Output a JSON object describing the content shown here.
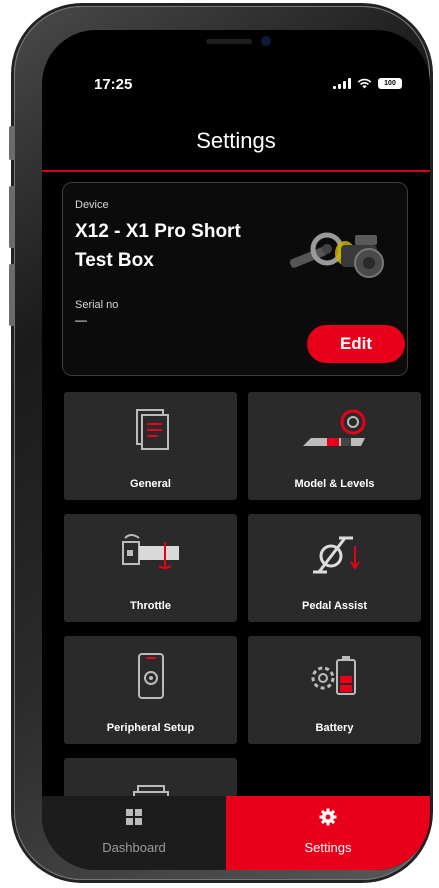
{
  "status_bar": {
    "time": "17:25",
    "battery": "100"
  },
  "header": {
    "title": "Settings"
  },
  "device_card": {
    "device_label": "Device",
    "device_name": "X12 - X1 Pro Short Test Box",
    "serial_label": "Serial no",
    "serial_value": "—",
    "edit_label": "Edit"
  },
  "tiles": [
    {
      "label": "General",
      "icon": "documents-icon"
    },
    {
      "label": "Model & Levels",
      "icon": "model-levels-icon"
    },
    {
      "label": "Throttle",
      "icon": "throttle-icon"
    },
    {
      "label": "Pedal Assist",
      "icon": "pedal-assist-icon"
    },
    {
      "label": "Peripheral Setup",
      "icon": "peripheral-setup-icon"
    },
    {
      "label": "Battery",
      "icon": "battery-settings-icon"
    }
  ],
  "tab_bar": {
    "tabs": [
      {
        "label": "Dashboard",
        "icon": "grid-icon",
        "active": false
      },
      {
        "label": "Settings",
        "icon": "gear-icon",
        "active": true
      }
    ]
  },
  "colors": {
    "accent": "#e8001b",
    "tile_bg": "#2a2a2a",
    "screen_bg": "#000000"
  }
}
